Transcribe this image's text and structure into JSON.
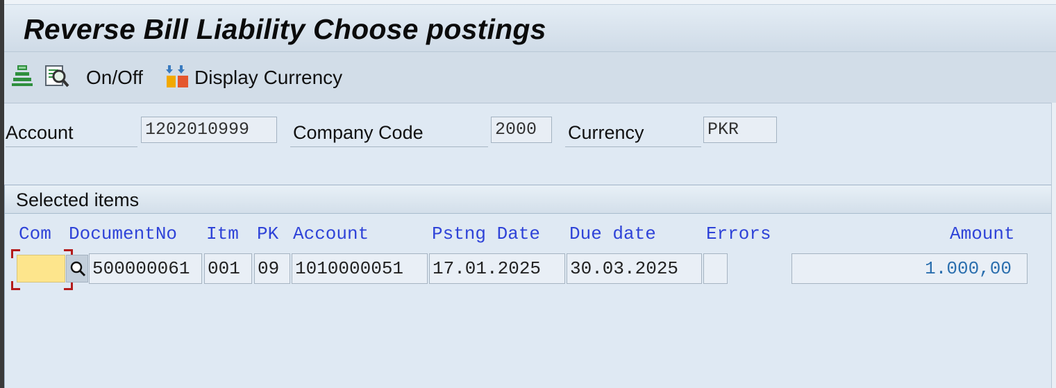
{
  "title": "Reverse Bill Liability Choose postings",
  "toolbar": {
    "on_off_label": "On/Off",
    "display_currency_label": "Display Currency"
  },
  "header": {
    "account_label": "Account",
    "account_value": "1202010999",
    "company_code_label": "Company Code",
    "company_code_value": "2000",
    "currency_label": "Currency",
    "currency_value": "PKR"
  },
  "selected_items": {
    "title": "Selected items",
    "columns": [
      "Com",
      "DocumentNo",
      "Itm",
      "PK",
      "Account",
      "Pstng Date",
      "Due date",
      "Errors",
      "Amount"
    ],
    "rows": [
      {
        "com": "",
        "document_no": "500000061",
        "itm": "001",
        "pk": "09",
        "account": "1010000051",
        "posting_date": "17.01.2025",
        "due_date": "30.03.2025",
        "errors": "",
        "amount": "1.000,00"
      }
    ]
  },
  "icons": {
    "printer": "print-icon",
    "find": "find-icon",
    "currency": "display-currency-icon",
    "value_help": "value-help-icon"
  },
  "colors": {
    "column_header": "#2f43d8",
    "amount": "#2b6fae",
    "required_input": "#fde58c",
    "focus_marker": "#b41c1c"
  }
}
